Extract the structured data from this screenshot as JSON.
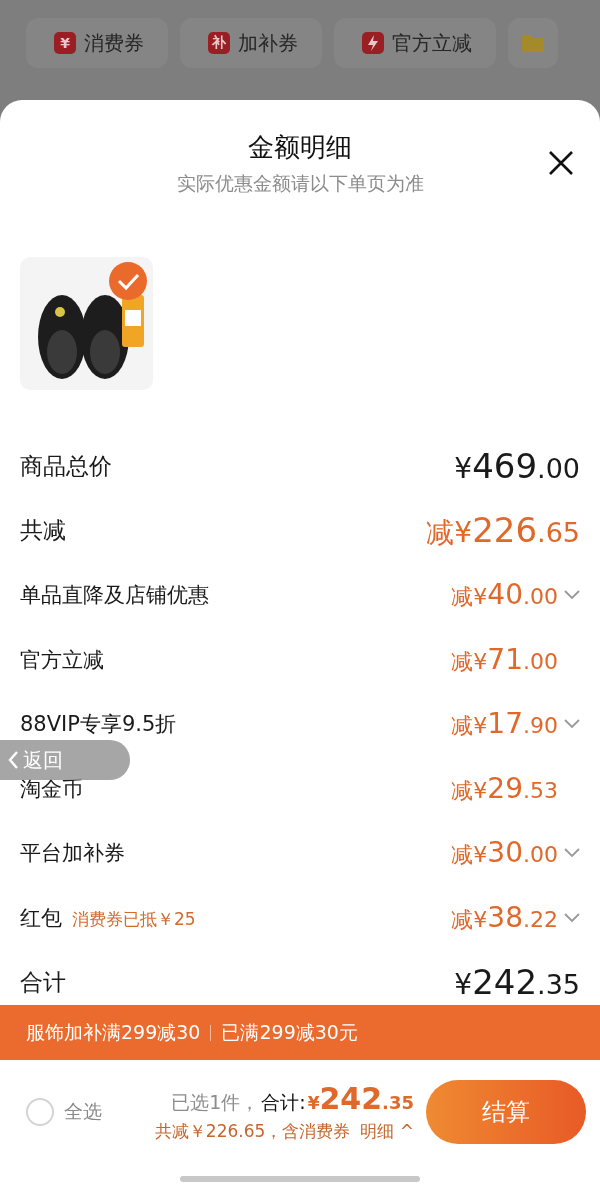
{
  "backdrop_chips": [
    {
      "kind": "glyph",
      "glyph": "¥",
      "label": "消费券"
    },
    {
      "kind": "glyph",
      "glyph": "补",
      "label": "加补券"
    },
    {
      "kind": "bolt",
      "label": "官方立减"
    },
    {
      "kind": "folder"
    }
  ],
  "sheet": {
    "title": "金额明细",
    "subtitle": "实际优惠金额请以下单页为准",
    "rows": [
      {
        "kind": "total",
        "label": "商品总价",
        "amount": {
          "prefix": "¥",
          "whole": "469",
          "fraction": ".00"
        }
      },
      {
        "kind": "discount_total",
        "label": "共减",
        "amount": {
          "prefix": "减¥",
          "whole": "226",
          "fraction": ".65"
        }
      },
      {
        "kind": "item",
        "label": "单品直降及店铺优惠",
        "amount": {
          "prefix": "减¥",
          "whole": "40",
          "fraction": ".00"
        },
        "expandable": true
      },
      {
        "kind": "item",
        "label": "官方立减",
        "amount": {
          "prefix": "减¥",
          "whole": "71",
          "fraction": ".00"
        },
        "expandable": false
      },
      {
        "kind": "item",
        "label": "88VIP专享9.5折",
        "amount": {
          "prefix": "减¥",
          "whole": "17",
          "fraction": ".90"
        },
        "expandable": true
      },
      {
        "kind": "item",
        "label": "淘金币",
        "amount": {
          "prefix": "减¥",
          "whole": "29",
          "fraction": ".53"
        },
        "expandable": false
      },
      {
        "kind": "item",
        "label": "平台加补券",
        "amount": {
          "prefix": "减¥",
          "whole": "30",
          "fraction": ".00"
        },
        "expandable": true
      },
      {
        "kind": "item",
        "label": "红包",
        "note": "消费券已抵￥25",
        "amount": {
          "prefix": "减¥",
          "whole": "38",
          "fraction": ".22"
        },
        "expandable": true
      },
      {
        "kind": "total",
        "label": "合计",
        "amount": {
          "prefix": "¥",
          "whole": "242",
          "fraction": ".35"
        }
      }
    ]
  },
  "back_button": {
    "label": "返回"
  },
  "promo_banner": {
    "left": "服饰加补满299减30",
    "right": "已满299减30元"
  },
  "checkout_bar": {
    "select_all": {
      "label": "全选",
      "checked": false
    },
    "selected_count": "已选1件，",
    "total_label": "合计:",
    "total": {
      "prefix": "¥",
      "whole": "242",
      "fraction": ".35"
    },
    "saving_note": "共减￥226.65，含消费券",
    "details_link": "明细 ^",
    "checkout_button": "结算"
  }
}
